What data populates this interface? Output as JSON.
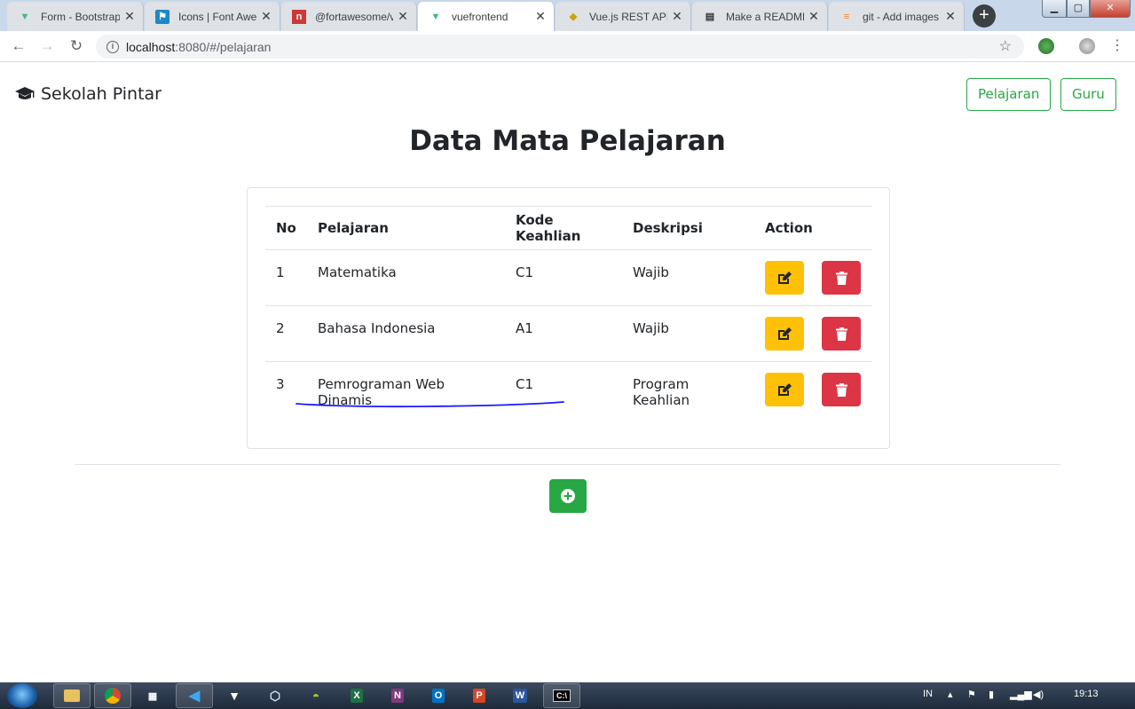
{
  "browser": {
    "tabs": [
      {
        "title": "Form - Bootstrap",
        "favicon": "vue-icon",
        "color": "#41b883"
      },
      {
        "title": "Icons | Font Awe",
        "favicon": "font-awesome-flag-icon",
        "color": "#1c88c7"
      },
      {
        "title": "@fortawesome/v",
        "favicon": "npm-icon",
        "color": "#cb3837"
      },
      {
        "title": "vuefrontend",
        "favicon": "vue-icon",
        "color": "#41b883",
        "active": true
      },
      {
        "title": "Vue.js REST API C",
        "favicon": "python-icon",
        "color": "#f1c40f"
      },
      {
        "title": "Make a README",
        "favicon": "document-icon",
        "color": "#333333"
      },
      {
        "title": "git - Add images",
        "favicon": "stackoverflow-icon",
        "color": "#f48024"
      }
    ],
    "url_host": "localhost",
    "url_rest": ":8080/#/pelajaran"
  },
  "navbar": {
    "brand": "Sekolah Pintar",
    "links": [
      "Pelajaran",
      "Guru"
    ]
  },
  "page": {
    "title": "Data Mata Pelajaran"
  },
  "table": {
    "headers": [
      "No",
      "Pelajaran",
      "Kode Keahlian",
      "Deskripsi",
      "Action"
    ],
    "rows": [
      {
        "no": "1",
        "pelajaran": "Matematika",
        "kode": "C1",
        "deskripsi": "Wajib"
      },
      {
        "no": "2",
        "pelajaran": "Bahasa Indonesia",
        "kode": "A1",
        "deskripsi": "Wajib"
      },
      {
        "no": "3",
        "pelajaran": "Pemrograman Web Dinamis",
        "kode": "C1",
        "deskripsi": "Program Keahlian"
      }
    ]
  },
  "colors": {
    "success": "#28a745",
    "warning": "#ffc107",
    "danger": "#dc3545"
  },
  "taskbar": {
    "lang": "IN",
    "time": "19:13"
  }
}
